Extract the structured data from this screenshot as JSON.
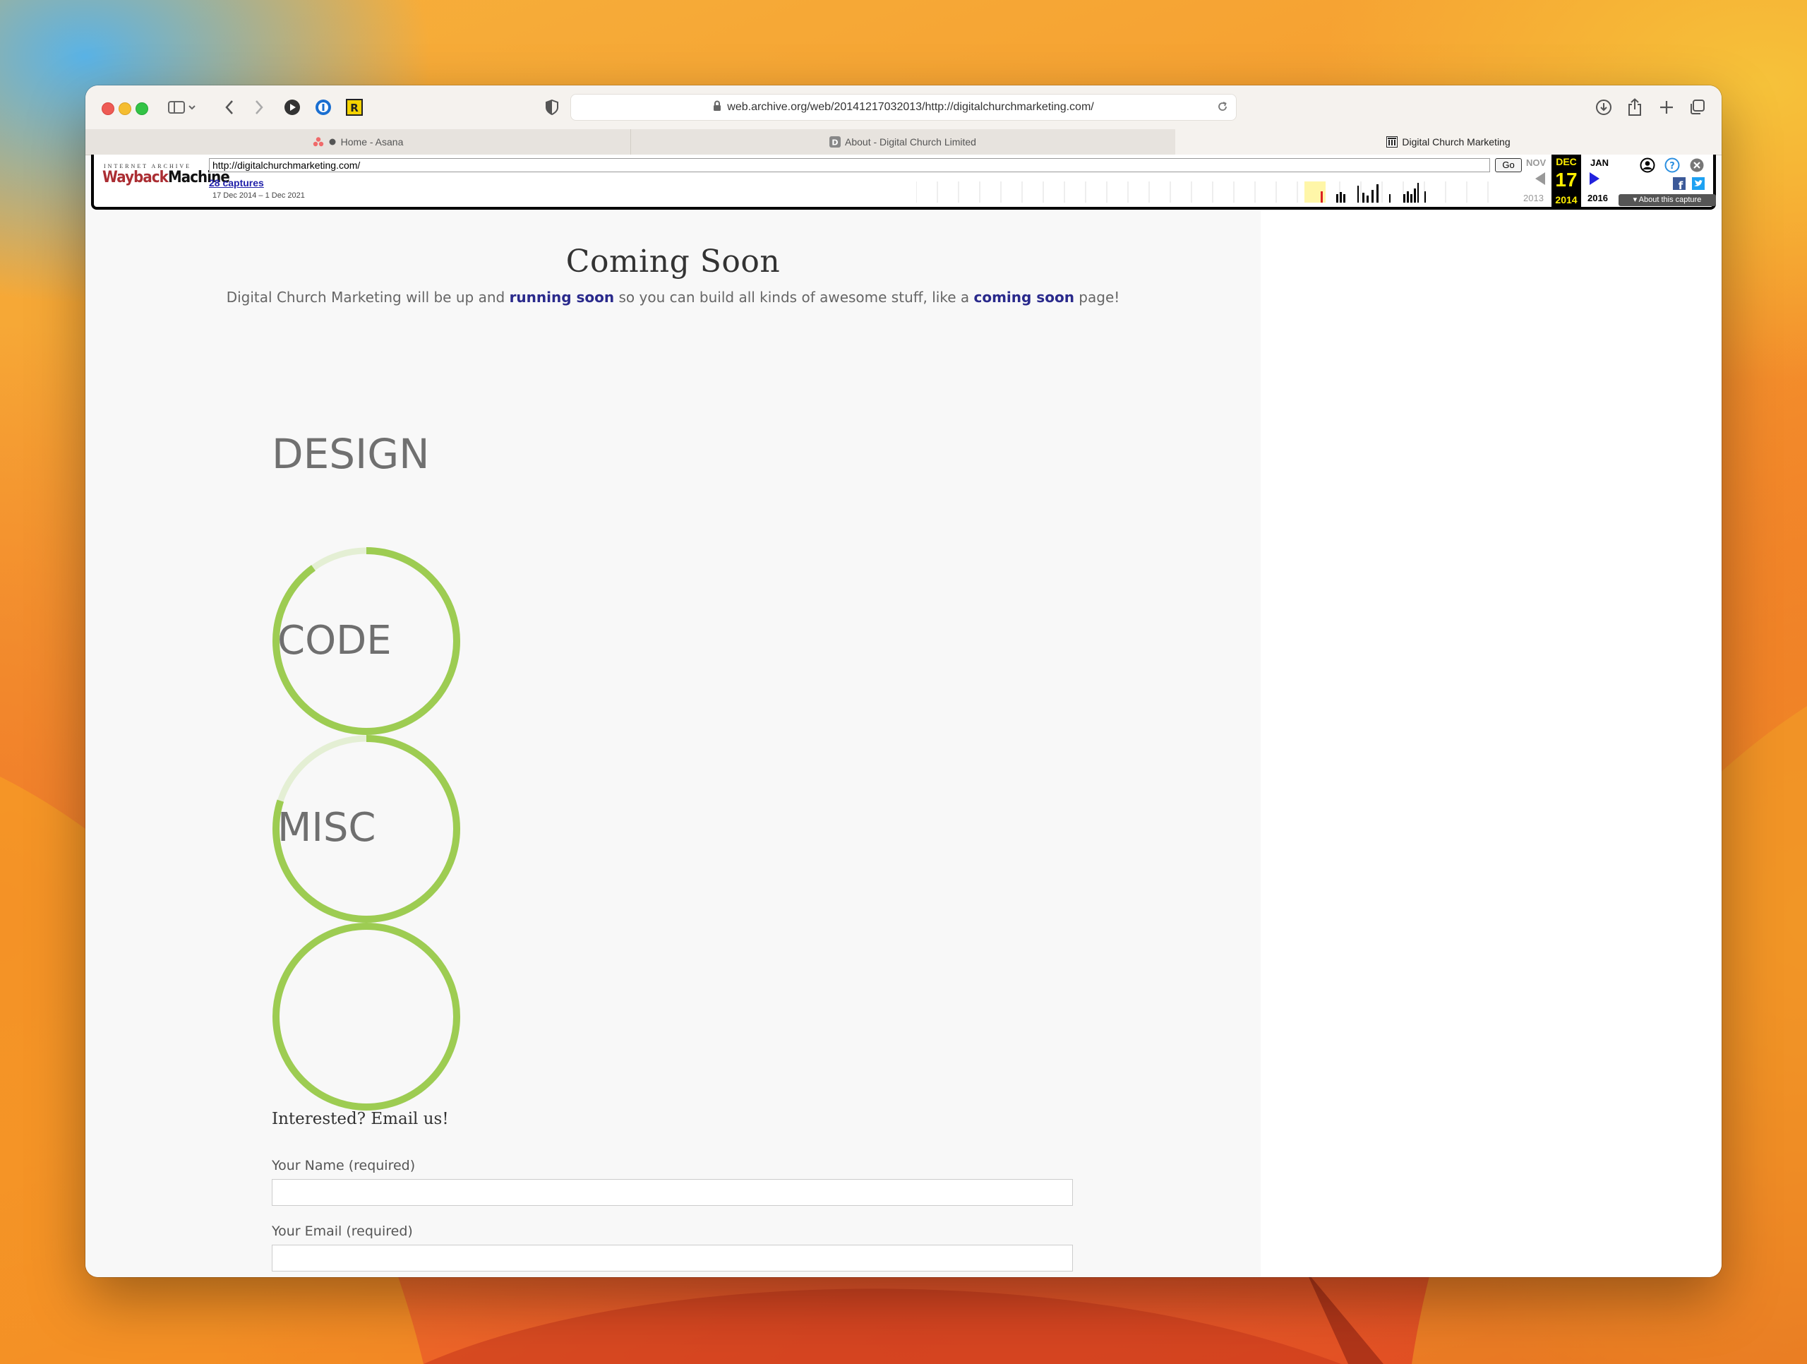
{
  "browser": {
    "url": "web.archive.org/web/20141217032013/http://digitalchurchmarketing.com/",
    "tabs": [
      {
        "label": "Home - Asana",
        "active": false
      },
      {
        "label": "About - Digital Church Limited",
        "active": false
      },
      {
        "label": "Digital Church Marketing",
        "active": true
      }
    ]
  },
  "wayback": {
    "logo_top": "INTERNET ARCHIVE",
    "logo_part1": "Wayback",
    "logo_part2": "Machine",
    "url_value": "http://digitalchurchmarketing.com/",
    "go_label": "Go",
    "captures_label": "28 captures",
    "range_label": "17 Dec 2014 – 1 Dec 2021",
    "prev_month": "NOV",
    "current_month": "DEC",
    "next_month": "JAN",
    "current_day": "17",
    "prev_year": "2013",
    "current_year": "2014",
    "next_year": "2016",
    "about_label": "About this capture"
  },
  "page": {
    "title": "Coming Soon",
    "subtitle_parts": [
      "Digital Church Marketing will be up and ",
      "running soon",
      " so you can build all kinds of awesome stuff, like a ",
      "coming soon",
      " page!"
    ],
    "skill_design": "DESIGN",
    "skills": [
      {
        "label": "CODE",
        "progress": 0.9
      },
      {
        "label": "MISC",
        "progress": 0.8
      },
      {
        "label": "",
        "progress": 1.0
      }
    ],
    "contact_heading": "Interested? Email us!",
    "fields": [
      {
        "label": "Your Name (required)",
        "value": ""
      },
      {
        "label": "Your Email (required)",
        "value": ""
      }
    ]
  },
  "colors": {
    "ring_green": "#9dcc52",
    "ring_track": "#e4efd4",
    "link_blue": "#2a2a8c"
  }
}
